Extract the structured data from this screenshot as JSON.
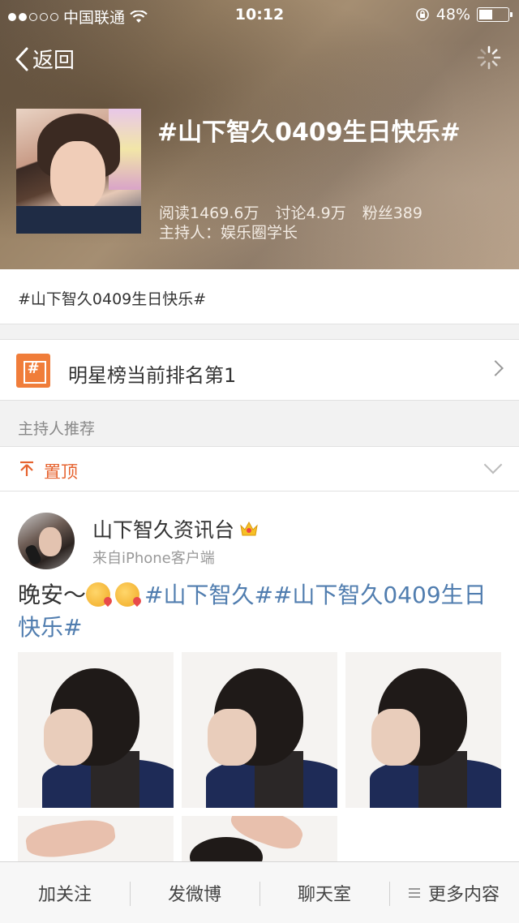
{
  "status_bar": {
    "carrier": "中国联通",
    "time": "10:12",
    "battery": "48%"
  },
  "nav": {
    "back_label": "返回"
  },
  "topic": {
    "title": "#山下智久0409生日快乐#",
    "reads": "阅读1469.6万",
    "discussions": "讨论4.9万",
    "fans": "粉丝389",
    "host": "主持人：娱乐圈学长"
  },
  "intro": {
    "text": "#山下智久0409生日快乐#"
  },
  "rank": {
    "label": "明星榜当前排名第1"
  },
  "section": {
    "host_recommend": "主持人推荐"
  },
  "pinned": {
    "label": "置顶"
  },
  "post": {
    "author": "山下智久资讯台",
    "source": "来自iPhone客户端",
    "text_plain": "晚安～",
    "topic_1": "#山下智久#",
    "topic_2": "#山下智久0409生日快乐#"
  },
  "tabbar": {
    "follow": "加关注",
    "post_weibo": "发微博",
    "chat_room": "聊天室",
    "more": "更多内容"
  },
  "colors": {
    "accent_orange": "#e6632f",
    "topic_blue": "#507daf"
  }
}
